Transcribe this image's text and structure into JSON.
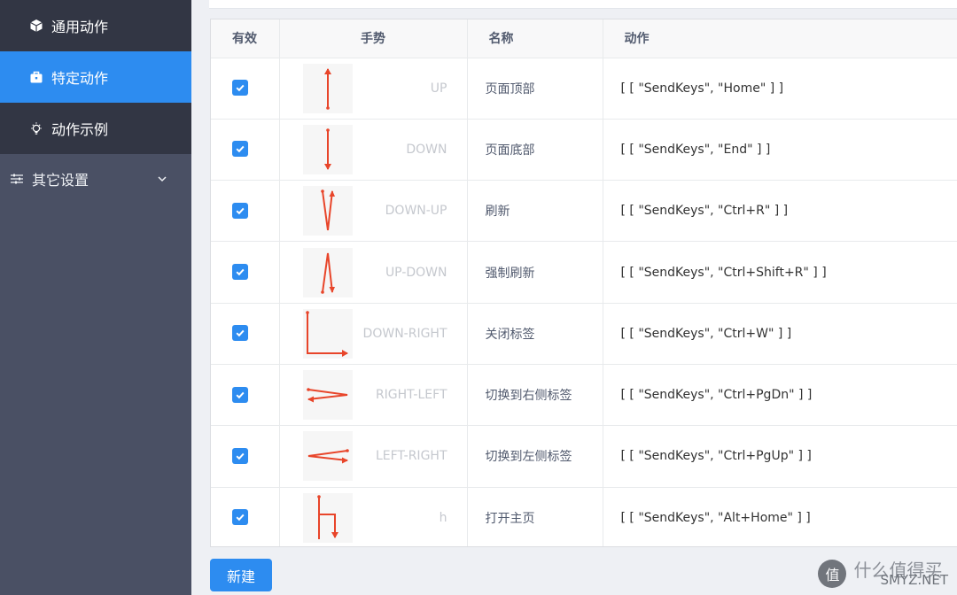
{
  "sidebar": {
    "items": [
      {
        "label": "通用动作",
        "icon": "cube-icon",
        "active": false
      },
      {
        "label": "特定动作",
        "icon": "briefcase-icon",
        "active": true
      },
      {
        "label": "动作示例",
        "icon": "lightbulb-icon",
        "active": false
      }
    ],
    "group": {
      "label": "其它设置",
      "icon": "sliders-icon",
      "expanded": false
    }
  },
  "table": {
    "headers": {
      "valid": "有效",
      "gesture": "手势",
      "name": "名称",
      "action": "动作"
    },
    "rows": [
      {
        "checked": true,
        "gesture": "UP",
        "name": "页面顶部",
        "action": "[ [ \"SendKeys\", \"Home\" ] ]"
      },
      {
        "checked": true,
        "gesture": "DOWN",
        "name": "页面底部",
        "action": "[ [ \"SendKeys\", \"End\" ] ]"
      },
      {
        "checked": true,
        "gesture": "DOWN-UP",
        "name": "刷新",
        "action": "[ [ \"SendKeys\", \"Ctrl+R\" ] ]"
      },
      {
        "checked": true,
        "gesture": "UP-DOWN",
        "name": "强制刷新",
        "action": "[ [ \"SendKeys\", \"Ctrl+Shift+R\" ] ]"
      },
      {
        "checked": true,
        "gesture": "DOWN-RIGHT",
        "name": "关闭标签",
        "action": "[ [ \"SendKeys\", \"Ctrl+W\" ] ]"
      },
      {
        "checked": true,
        "gesture": "RIGHT-LEFT",
        "name": "切换到右侧标签",
        "action": "[ [ \"SendKeys\", \"Ctrl+PgDn\" ] ]"
      },
      {
        "checked": true,
        "gesture": "LEFT-RIGHT",
        "name": "切换到左侧标签",
        "action": "[ [ \"SendKeys\", \"Ctrl+PgUp\" ] ]"
      },
      {
        "checked": true,
        "gesture": "h",
        "name": "打开主页",
        "action": "[ [ \"SendKeys\", \"Alt+Home\" ] ]"
      }
    ]
  },
  "new_button": "新建",
  "watermark": {
    "logo": "值",
    "cn": "什么值得买",
    "en": "SMYZ.NET"
  },
  "colors": {
    "accent": "#2d8cf0",
    "gesture_stroke": "#e8452a",
    "sidebar_bg": "#4a5064",
    "sidebar_sub_bg": "#323644"
  }
}
